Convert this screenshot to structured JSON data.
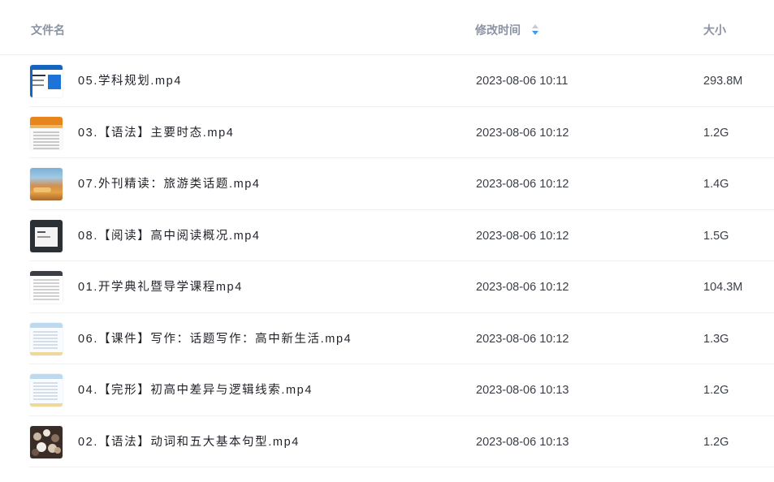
{
  "header": {
    "col_name": "文件名",
    "col_time": "修改时间",
    "col_size": "大小",
    "sort_icon": "sort-arrows-icon"
  },
  "files": [
    {
      "name": "05.学科规划.mp4",
      "modified": "2023-08-06 10:11",
      "size": "293.8M",
      "thumb": "plan"
    },
    {
      "name": "03.【语法】主要时态.mp4",
      "modified": "2023-08-06 10:12",
      "size": "1.2G",
      "thumb": "grammar"
    },
    {
      "name": "07.外刊精读：旅游类话题.mp4",
      "modified": "2023-08-06 10:12",
      "size": "1.4G",
      "thumb": "photo"
    },
    {
      "name": "08.【阅读】高中阅读概况.mp4",
      "modified": "2023-08-06 10:12",
      "size": "1.5G",
      "thumb": "read"
    },
    {
      "name": "01.开学典礼暨导学课程mp4",
      "modified": "2023-08-06 10:12",
      "size": "104.3M",
      "thumb": "open"
    },
    {
      "name": "06.【课件】写作：话题写作：高中新生活.mp4",
      "modified": "2023-08-06 10:12",
      "size": "1.3G",
      "thumb": "write"
    },
    {
      "name": "04.【完形】初高中差异与逻辑线索.mp4",
      "modified": "2023-08-06 10:13",
      "size": "1.2G",
      "thumb": "write"
    },
    {
      "name": "02.【语法】动词和五大基本句型.mp4",
      "modified": "2023-08-06 10:13",
      "size": "1.2G",
      "thumb": "crowd"
    }
  ],
  "colors": {
    "header_text": "#8a93a3",
    "row_text": "#1f2329",
    "sort_active": "#3a9af5",
    "sort_inactive": "#c5cad3",
    "divider": "#eef0f2"
  }
}
